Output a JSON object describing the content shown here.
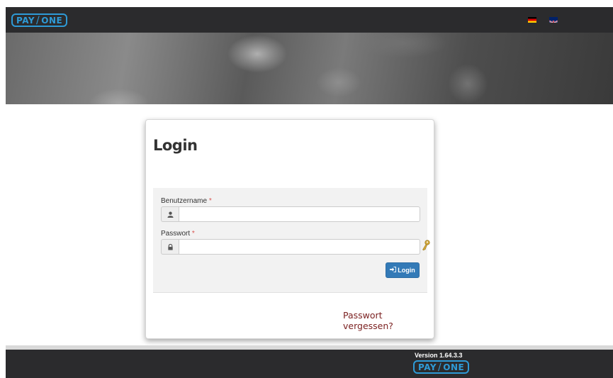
{
  "header": {
    "logo_left": "PAY",
    "logo_right": "ONE",
    "languages": [
      {
        "code": "de",
        "icon": "flag-de-icon"
      },
      {
        "code": "en",
        "icon": "flag-gb-icon"
      }
    ]
  },
  "login": {
    "title": "Login",
    "username_label": "Benutzername",
    "password_label": "Passwort",
    "required_marker": "*",
    "username_value": "",
    "password_value": "",
    "submit_label": "Login",
    "forgot_link": "Passwort vergessen?"
  },
  "footer": {
    "version": "Version 1.64.3.3",
    "logo_left": "PAY",
    "logo_right": "ONE"
  },
  "colors": {
    "accent": "#2e9ad6",
    "bar": "#2b2b2d",
    "button": "#337ab7",
    "link": "#7a1f1f",
    "required": "#d9534f"
  }
}
